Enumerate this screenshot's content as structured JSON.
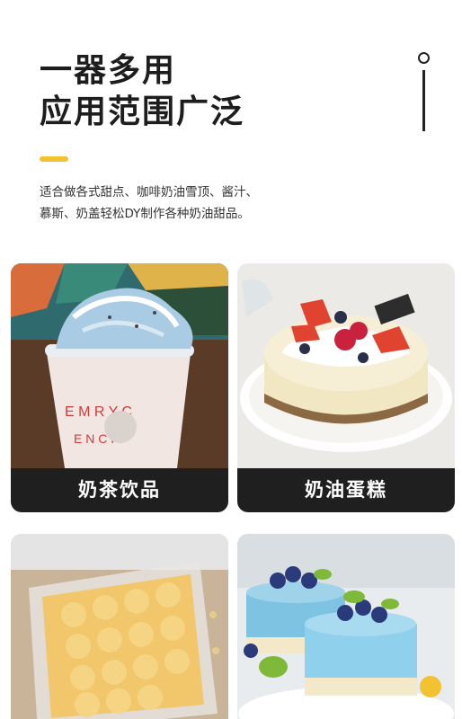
{
  "header": {
    "title_line1": "一器多用",
    "title_line2": "应用范围广泛",
    "description_line1": "适合做各式甜点、咖啡奶油雪顶、酱汁、",
    "description_line2": "慕斯、奶盖轻松DY制作各种奶油甜品。"
  },
  "cards": [
    {
      "caption": "奶茶饮品",
      "icon": "milk-tea-drink-photo"
    },
    {
      "caption": "奶油蛋糕",
      "icon": "cream-cake-photo"
    },
    {
      "caption": "",
      "icon": "cream-dessert-box-photo"
    },
    {
      "caption": "",
      "icon": "mousse-cake-photo"
    }
  ],
  "colors": {
    "accent": "#f2c230",
    "caption_bg": "#1f1f1f",
    "title": "#1d1d1d"
  }
}
